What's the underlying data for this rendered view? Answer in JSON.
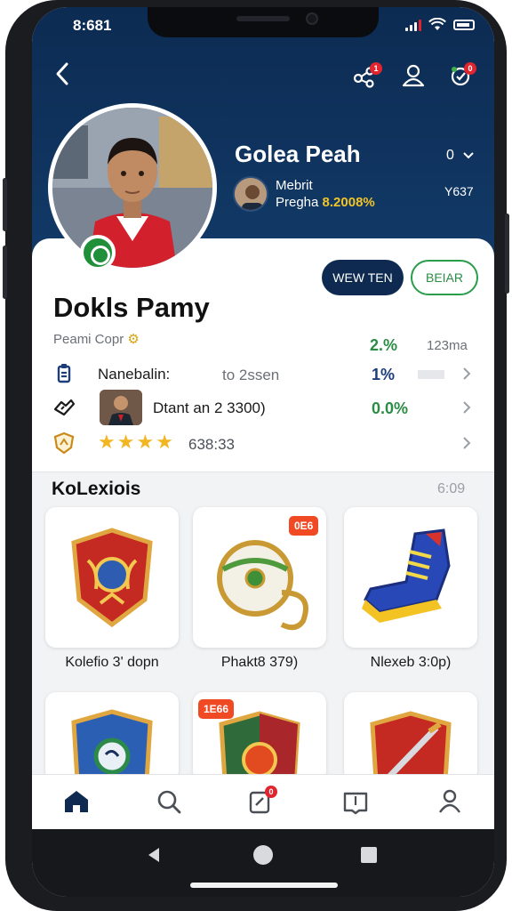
{
  "status_bar": {
    "time": "8:681"
  },
  "header": {
    "name": "Golea Peah",
    "meta": "0",
    "sub_line1": "Mebrit",
    "sub_line2_prefix": "Pregha",
    "sub_line2_highlight": "8.2008%",
    "right_value": "Y637",
    "badges": {
      "icon1": "1",
      "icon3": "0"
    }
  },
  "card": {
    "primary_button": "WEW TEN",
    "secondary_button": "BEIAR",
    "name": "Dokls Pamy",
    "subtitle": "Peami Copr",
    "stat_percent": "2.%",
    "stat_value": "123ma",
    "rows": [
      {
        "label": "Nanebalin:",
        "value": "to 2ssen",
        "stat": "1%",
        "stat_color": "#1d3d7a"
      },
      {
        "label": "Dtant an 2 3300)",
        "stat": "0.0%",
        "stat_color": "#2a8c45"
      },
      {
        "rating": 4,
        "value": "638:33"
      }
    ]
  },
  "collections": {
    "title": "KoLexiois",
    "meta": "6:09",
    "items": [
      {
        "label": "Kolefio 3' dopn",
        "tag": ""
      },
      {
        "label": "Phakt8 379)",
        "tag": "0E6"
      },
      {
        "label": "Nlexeb 3:0p)",
        "tag": ""
      },
      {
        "label": "",
        "tag": "1E66"
      },
      {
        "label": "",
        "tag": ""
      },
      {
        "label": "",
        "tag": ""
      }
    ]
  },
  "tabbar": {
    "active": "home-tab",
    "badge": "0"
  },
  "colors": {
    "navy": "#0f2a50",
    "green": "#2a8c45",
    "gold": "#f3b623",
    "red": "#e0252f"
  }
}
